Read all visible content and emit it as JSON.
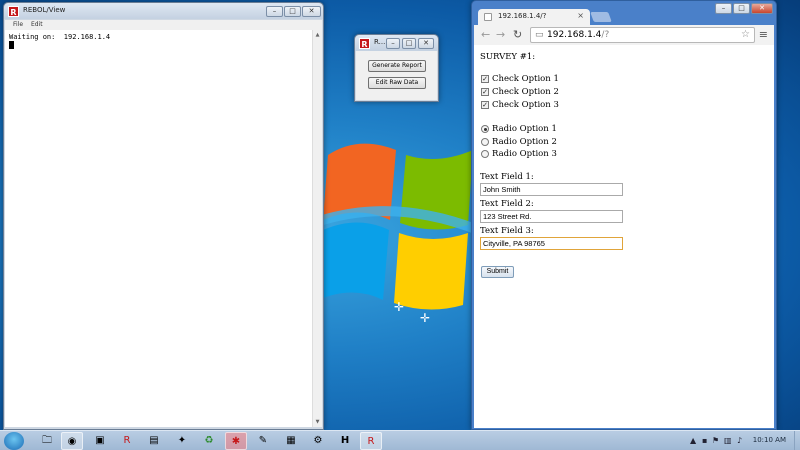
{
  "rebol_window": {
    "title": "REBOL/View",
    "menu": [
      "File",
      "Edit"
    ],
    "console_text": "Waiting on:  192.168.1.4"
  },
  "app_window": {
    "title": "R...",
    "buttons": [
      "Generate Report",
      "Edit Raw Data"
    ]
  },
  "browser": {
    "tab_title": "192.168.1.4/?",
    "tab_close": "×",
    "url_host": "192.168.1.4",
    "url_path": "/?",
    "page": {
      "heading": "SURVEY #1:",
      "checkboxes": [
        {
          "label": "Check Option 1",
          "checked": true
        },
        {
          "label": "Check Option 2",
          "checked": true
        },
        {
          "label": "Check Option 3",
          "checked": true
        }
      ],
      "radios": [
        {
          "label": "Radio Option 1",
          "selected": true
        },
        {
          "label": "Radio Option 2",
          "selected": false
        },
        {
          "label": "Radio Option 3",
          "selected": false
        }
      ],
      "text_fields": [
        {
          "label": "Text Field 1:",
          "value": "John Smith"
        },
        {
          "label": "Text Field 2:",
          "value": "123 Street Rd."
        },
        {
          "label": "Text Field 3:",
          "value": "Cityville, PA  98765"
        }
      ],
      "submit_label": "Submit"
    }
  },
  "taskbar": {
    "clock": "10:10 AM",
    "items": [
      "explorer-icon",
      "chrome-icon",
      "app-icon",
      "rebol-icon",
      "folder-icon",
      "network-icon",
      "recycle-icon",
      "rebol-active-icon",
      "paint-icon",
      "tool-icon",
      "media-icon",
      "h-icon",
      "rebol-icon-2"
    ]
  },
  "colors": {
    "rebol_red": "#c5181a",
    "chrome_frame": "#4a80c9",
    "focus_border": "#e0a43a"
  }
}
